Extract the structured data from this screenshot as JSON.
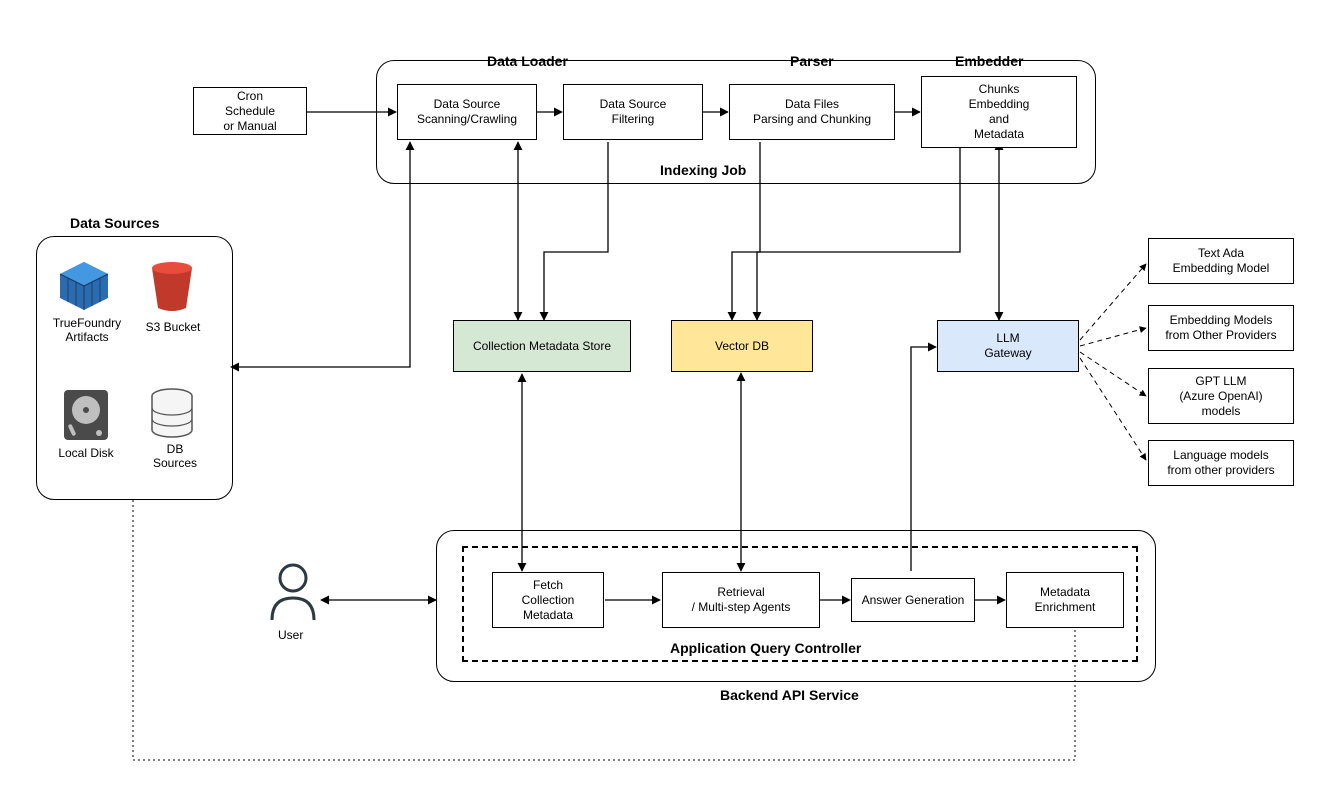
{
  "cron": {
    "text": "Cron\nSchedule\nor Manual"
  },
  "indexing": {
    "frame_label": "Indexing Job",
    "data_loader_label": "Data Loader",
    "parser_label": "Parser",
    "embedder_label": "Embedder",
    "scan": "Data Source\nScanning/Crawling",
    "filter": "Data Source\nFiltering",
    "parse": "Data Files\nParsing and Chunking",
    "embed": "Chunks\nEmbedding\nand\nMetadata"
  },
  "sources": {
    "frame_label": "Data Sources",
    "truefoundry": "TrueFoundry\nArtifacts",
    "s3": "S3 Bucket",
    "localdisk": "Local Disk",
    "db": "DB\nSources"
  },
  "stores": {
    "collection": "Collection Metadata Store",
    "vector": "Vector DB",
    "llm": "LLM\nGateway"
  },
  "backend": {
    "frame_label": "Backend API Service",
    "controller_label": "Application Query Controller",
    "fetch": "Fetch\nCollection\nMetadata",
    "retrieval": "Retrieval\n/ Multi-step Agents",
    "answer": "Answer Generation",
    "enrich": "Metadata\nEnrichment"
  },
  "user_label": "User",
  "llm_targets": {
    "ada": "Text Ada\nEmbedding Model",
    "emb_other": "Embedding Models\nfrom Other Providers",
    "gpt": "GPT LLM\n(Azure OpenAI)\nmodels",
    "lang_other": "Language models\nfrom other providers"
  }
}
